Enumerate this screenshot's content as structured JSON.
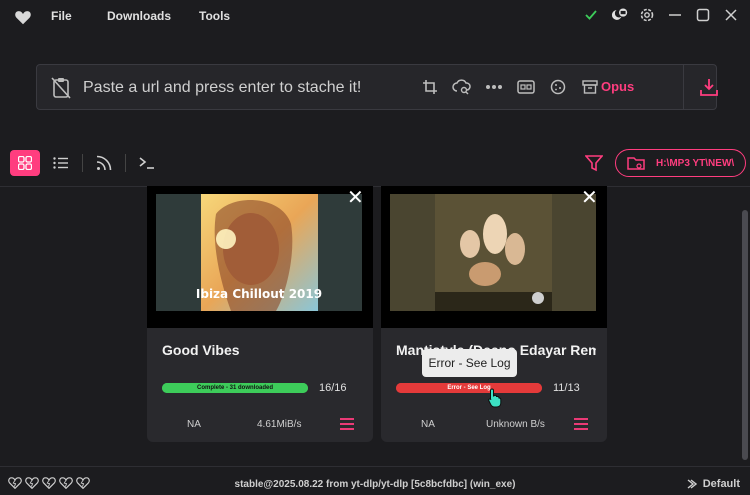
{
  "menu": {
    "file": "File",
    "downloads": "Downloads",
    "tools": "Tools"
  },
  "url": {
    "placeholder": "Paste a url and press enter to stache it!",
    "format": "Opus"
  },
  "folder": {
    "path": "H:\\MP3 YT\\NEW\\"
  },
  "cards": [
    {
      "title": "Good Vibes",
      "thumb_text": "Ibiza Chillout 2019",
      "progress_label": "Complete - 31 downloaded",
      "progress_value": 1.0,
      "progress_color": "#3dcc5a",
      "count": "16/16",
      "na": "NA",
      "speed": "4.61MiB/s"
    },
    {
      "title": "Mantistyle (Deeno Edayar Remix)",
      "progress_label": "Error - See Log",
      "progress_value": 1.0,
      "progress_color": "#e43a3a",
      "count": "11/13",
      "na": "NA",
      "speed": "Unknown B/s"
    }
  ],
  "tooltip": "Error - See Log",
  "status": {
    "version": "stable@2025.08.22 from yt-dlp/yt-dlp [5c8bcfdbc] (win_exe)",
    "profile": "Default"
  },
  "colors": {
    "accent": "#ff3d7f",
    "success": "#3dcc5a",
    "error": "#e43a3a"
  }
}
